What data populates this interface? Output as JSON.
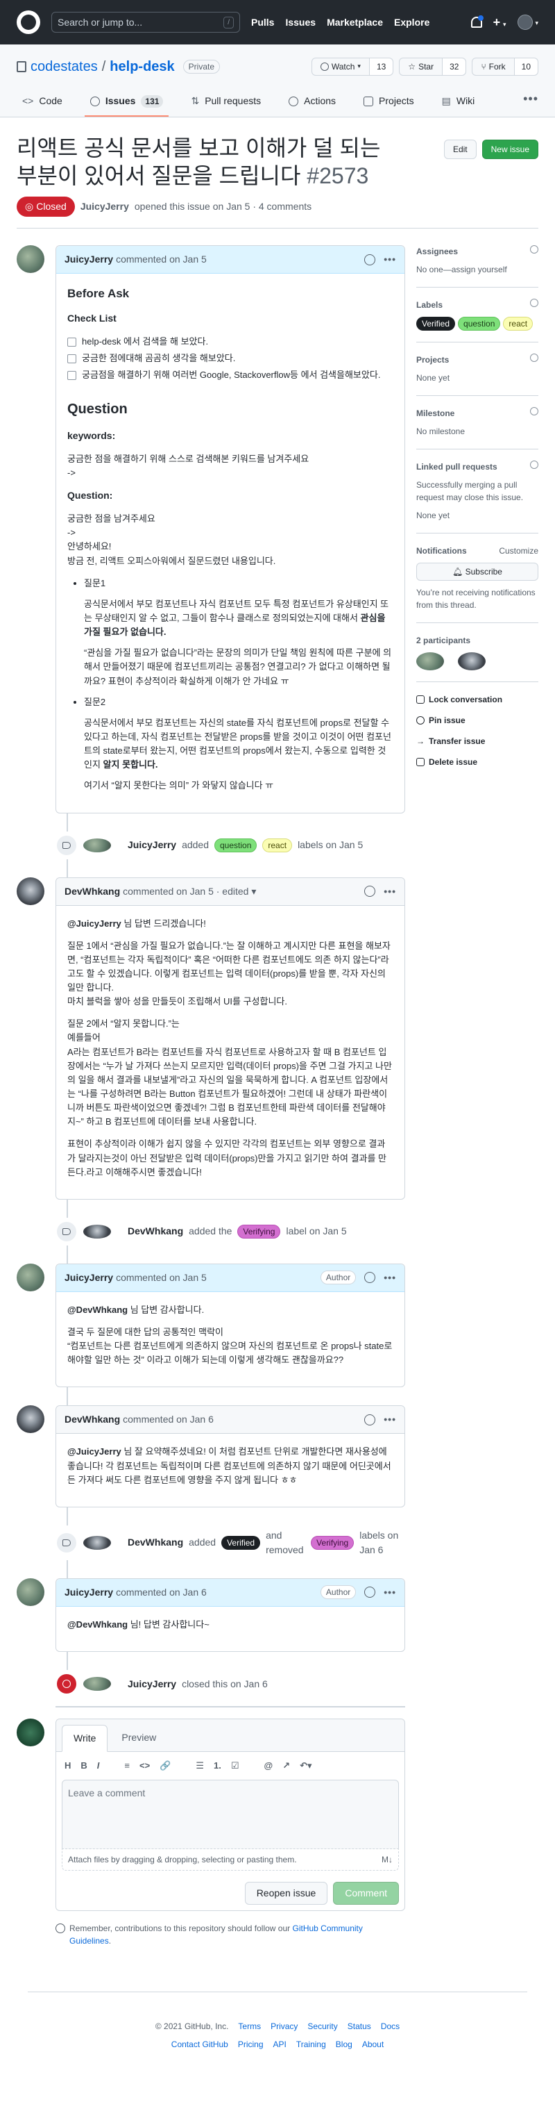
{
  "header": {
    "search_placeholder": "Search or jump to...",
    "search_key": "/",
    "nav": [
      "Pulls",
      "Issues",
      "Marketplace",
      "Explore"
    ],
    "plus": "+",
    "caret": "▾"
  },
  "repo": {
    "owner": "codestates",
    "sep": "/",
    "name": "help-desk",
    "visibility": "Private",
    "watch_label": "Watch",
    "watch_count": "13",
    "star_label": "Star",
    "star_count": "32",
    "fork_label": "Fork",
    "fork_count": "10",
    "tabs": [
      {
        "label": "Code"
      },
      {
        "label": "Issues",
        "count": "131"
      },
      {
        "label": "Pull requests"
      },
      {
        "label": "Actions"
      },
      {
        "label": "Projects"
      },
      {
        "label": "Wiki"
      }
    ],
    "more": "•••"
  },
  "issue": {
    "title": "리액트 공식 문서를 보고 이해가 덜 되는 부분이 있어서 질문을 드립니다",
    "number": "#2573",
    "edit_label": "Edit",
    "new_issue_label": "New issue",
    "state": "Closed",
    "author": "JuicyJerry",
    "opened_text": "opened this issue on Jan 5 · 4 comments"
  },
  "comment1": {
    "author": "JuicyJerry",
    "meta": "commented on Jan 5",
    "before_ask": "Before Ask",
    "checklist_title": "Check List",
    "checklist": [
      "help-desk 에서 검색을 해 보았다.",
      "궁금한 점에대해 곰곰히 생각을 해보았다.",
      "궁금점을 해결하기 위해 여러번 Google, Stackoverflow등 에서 검색을해보았다."
    ],
    "question_heading": "Question",
    "keywords_label": "keywords:",
    "keywords_hint": "궁금한 점을 해결하기 위해 스스로 검색해본 키워드를 남겨주세요",
    "keywords_arrow": "->",
    "question_label": "Question:",
    "q_line1": "궁금한 점을 남겨주세요",
    "q_line2": "->",
    "q_line3": "안녕하세요!",
    "q_line4": "방금 전, 리액트 오피스아워에서 질문드렸던 내용입니다.",
    "item1_title": "질문1",
    "item1_text": "공식문서에서 부모 컴포넌트나 자식 컴포넌트 모두 특정 컴포넌트가 유상태인지 또는 무상태인지 알 수 없고, 그들이 함수나 클래스로 정의되었는지에 대해서 ",
    "item1_bold": "관심을 가질 필요가 없습니다.",
    "item1_text2": "“관심을 가질 필요가 없습니다”라는 문장의 의미가 단일 책임 원칙에 따른 구분에 의해서 만들어졌기 때문에 컴포넌트끼리는 공통점? 연결고리? 가 없다고 이해하면 될까요? 표현이 추상적이라 확실하게 이해가 안 가네요 ㅠ",
    "item2_title": "질문2",
    "item2_text": "공식문서에서 부모 컴포넌트는 자신의 state를 자식 컴포넌트에 props로 전달할 수 있다고 하는데, 자식 컴포넌트는 전달받은 props를 받을 것이고 이것이 어떤 컴포넌트의 state로부터 왔는지, 어떤 컴포넌트의 props에서 왔는지, 수동으로 입력한 것인지 ",
    "item2_bold": "알지 못합니다.",
    "item2_text2": "여기서 “알지 못한다는 의미” 가 와닿지 않습니다 ㅠ"
  },
  "event1": {
    "actor": "JuicyJerry",
    "verb": "added",
    "labels": [
      "question",
      "react"
    ],
    "suffix": "labels on Jan 5"
  },
  "comment2": {
    "author": "DevWhkang",
    "meta": "commented on Jan 5 · edited ▾",
    "mention": "@JuicyJerry",
    "p1": " 님 답변 드리겠습니다!",
    "p2": "질문 1에서 “관심을 가질 필요가 없습니다.”는 잘 이해하고 계시지만 다른 표현을 해보자면, “컴포넌트는 각자 독립적이다” 혹은 “어떠한 다른 컴포넌트에도 의존 하지 않는다”라고도 할 수 있겠습니다. 이렇게 컴포넌트는 입력 데이터(props)를 받을 뿐, 각자 자신의 일만 합니다.",
    "p3": "마치 블럭을 쌓아 성을 만들듯이 조립해서 UI를 구성합니다.",
    "p4a": "질문 2에서 “알지 못합니다.”는",
    "p4b": "예를들어",
    "p4c": "A라는 컴포넌트가 B라는 컴포넌트를 자식 컴포넌트로 사용하고자 할 때 B 컴포넌트 입장에서는 “누가 날 가져다 쓰는지 모르지만 입력(데이터 props)을 주면 그걸 가지고 나만의 일을 해서 결과를 내보낼게”라고 자신의 일을 묵묵하게 합니다. A 컴포넌트 입장에서는 “나를 구성하려면 B라는 Button 컴포넌트가 필요하겠어! 그런데 내 상태가 파란색이니까 버튼도 파란색이었으면 좋겠네?! 그럼 B 컴포넌트한테 파란색 데이터를 전달해야지~” 하고 B 컴포넌트에 데이터를 보내 사용합니다.",
    "p5": "표현이 추상적이라 이해가 쉽지 않을 수 있지만 각각의 컴포넌트는 외부 영향으로 결과가 달라지는것이 아닌 전달받은 입력 데이터(props)만을 가지고 읽기만 하여 결과를 만든다.라고 이해해주시면 좋겠습니다!"
  },
  "event2": {
    "actor": "DevWhkang",
    "verb": "added the",
    "label": "Verifying",
    "suffix": "label on Jan 5"
  },
  "comment3": {
    "author": "JuicyJerry",
    "meta": "commented on Jan 5",
    "badge": "Author",
    "mention": "@DevWhkang",
    "p1": " 님 답변 감사합니다.",
    "p2": "결국 두 질문에 대한 답의 공통적인 맥락이",
    "p3": "“컴포넌트는 다른 컴포넌트에게 의존하지 않으며 자신의 컴포넌트로 온 props나 state로 해야할 일만 하는 것” 이라고 이해가 되는데 이렇게 생각해도 괜찮을까요??"
  },
  "comment4": {
    "author": "DevWhkang",
    "meta": "commented on Jan 6",
    "mention": "@JuicyJerry",
    "p1": " 님 잘 요약해주셨네요! 이 처럼 컴포넌트 단위로 개발한다면 재사용성에 좋습니다! 각 컴포넌트는 독립적이며 다른 컴포넌트에 의존하지 않기 때문에 어딘곳에서든 가져다 써도 다른 컴포넌트에 영향을 주지 않게 됩니다 ㅎㅎ"
  },
  "event3": {
    "actor": "DevWhkang",
    "verb": "added",
    "label_added": "Verified",
    "mid": "and removed",
    "label_removed": "Verifying",
    "suffix": "labels on Jan 6"
  },
  "comment5": {
    "author": "JuicyJerry",
    "meta": "commented on Jan 6",
    "badge": "Author",
    "mention": "@DevWhkang",
    "p1": " 님! 답변 감사합니다~"
  },
  "event4": {
    "actor": "JuicyJerry",
    "suffix": "closed this on Jan 6"
  },
  "composer": {
    "tab_write": "Write",
    "tab_preview": "Preview",
    "toolbar": [
      "H",
      "B",
      "I",
      "≡",
      "<>",
      "🔗",
      "☰",
      "1.",
      "☑",
      "@",
      "↗",
      "↶▾"
    ],
    "placeholder": "Leave a comment",
    "attach_text": "Attach files by dragging & dropping, selecting or pasting them.",
    "md_badge": "M↓",
    "reopen_label": "Reopen issue",
    "comment_label": "Comment"
  },
  "remember": {
    "text": "Remember, contributions to this repository should follow our ",
    "link": "GitHub Community Guidelines",
    "end": "."
  },
  "sidebar": {
    "assignees_title": "Assignees",
    "assignees_text": "No one—assign yourself",
    "labels_title": "Labels",
    "labels": [
      "Verified",
      "question",
      "react"
    ],
    "projects_title": "Projects",
    "projects_text": "None yet",
    "milestone_title": "Milestone",
    "milestone_text": "No milestone",
    "linked_title": "Linked pull requests",
    "linked_desc": "Successfully merging a pull request may close this issue.",
    "linked_text": "None yet",
    "notifications_title": "Notifications",
    "customize": "Customize",
    "subscribe": "Subscribe",
    "notifications_desc": "You’re not receiving notifications from this thread.",
    "participants_title": "2 participants",
    "lock": "Lock conversation",
    "pin": "Pin issue",
    "transfer": "Transfer issue",
    "delete": "Delete issue"
  },
  "footer": {
    "copyright": "© 2021 GitHub, Inc.",
    "row1": [
      "Terms",
      "Privacy",
      "Security",
      "Status",
      "Docs"
    ],
    "row2": [
      "Contact GitHub",
      "Pricing",
      "API",
      "Training",
      "Blog",
      "About"
    ]
  },
  "colors": {
    "header_bg": "#24292f",
    "closed_red": "#cf222e",
    "green": "#2da44e",
    "label_question": "#7ee07a",
    "label_react": "#fbfdb3",
    "label_verifying": "#d36fd0",
    "label_verified": "#1b1f23"
  }
}
